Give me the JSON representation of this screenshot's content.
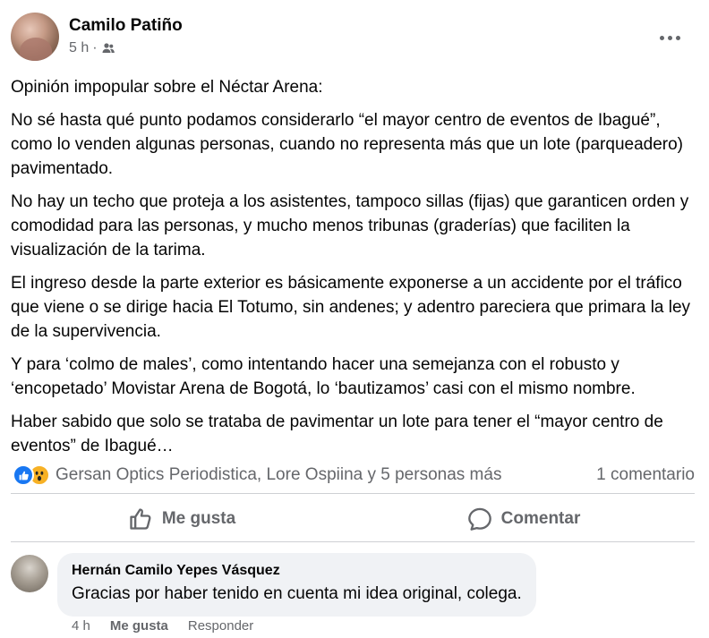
{
  "post": {
    "author": "Camilo Patiño",
    "time": "5 h",
    "audience_icon": "friends-icon",
    "paragraphs": [
      "Opinión impopular sobre el Néctar Arena:",
      "No sé hasta qué punto podamos considerarlo “el mayor centro de eventos de Ibagué”, como lo venden algunas personas, cuando no representa más que un lote (parqueadero) pavimentado.",
      "No hay un techo que proteja a los asistentes, tampoco sillas (fijas) que garanticen orden y comodidad para las personas, y mucho menos tribunas (graderías) que faciliten la visualización de la tarima.",
      "El ingreso desde la parte exterior es básicamente exponerse a un accidente por el tráfico que viene o se dirige hacia El Totumo, sin andenes; y adentro pareciera que primara la ley de la supervivencia.",
      "Y para ‘colmo de males’, como intentando hacer una semejanza con el robusto y ‘encopetado’ Movistar Arena de Bogotá, lo ‘bautizamos’ casi con el mismo nombre.",
      "Haber sabido que solo se trataba de pavimentar un lote para tener el “mayor centro de eventos” de Ibagué…"
    ]
  },
  "reactions": {
    "icons": [
      "like-icon",
      "wow-icon"
    ],
    "text": "Gersan Optics Periodistica, Lore Ospiina y 5 personas más",
    "comments_count": "1 comentario"
  },
  "actions": {
    "like_label": "Me gusta",
    "comment_label": "Comentar"
  },
  "comment": {
    "author": "Hernán Camilo Yepes Vásquez",
    "text": "Gracias por haber tenido en cuenta mi idea original, colega.",
    "time": "4 h",
    "like_label": "Me gusta",
    "reply_label": "Responder"
  },
  "colors": {
    "like_blue": "#1877f2",
    "wow_yellow": "#f7b125",
    "secondary_text": "#65676b",
    "comment_bubble": "#f0f2f5"
  }
}
